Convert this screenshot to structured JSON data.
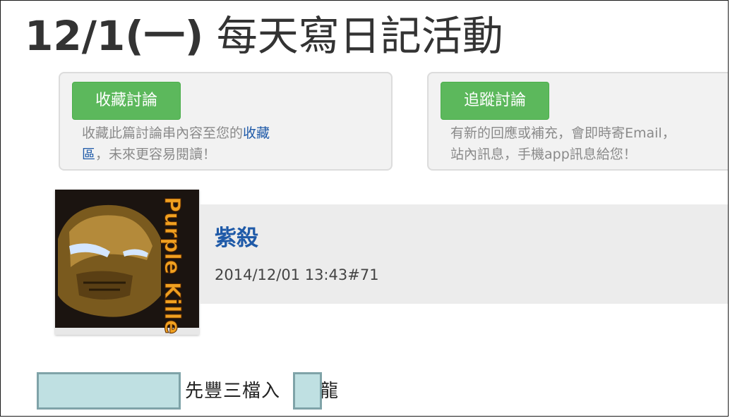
{
  "title": {
    "date": "12/1(一)",
    "text": "每天寫日記活動"
  },
  "favorite_card": {
    "button_label": "收藏討論",
    "desc_prefix": "收藏此篇討論串內容至您的",
    "desc_link_1": "收藏",
    "desc_link_2": "區",
    "desc_suffix": "，未來更容易閱讀！"
  },
  "follow_card": {
    "button_label": "追蹤討論",
    "desc_line1": "有新的回應或補充，會即時寄Email，",
    "desc_line2": "站內訊息，手機app訊息給您！"
  },
  "post": {
    "avatar_text": "Purple Killer",
    "author": "紫殺",
    "datetime": "2014/12/01 13:43#71",
    "content_part1": "先豐三檔入",
    "content_part2": "龍"
  },
  "colors": {
    "button_green": "#5cb85c",
    "link_blue": "#1f5aa8",
    "mask_fill": "#bfe0e2"
  }
}
